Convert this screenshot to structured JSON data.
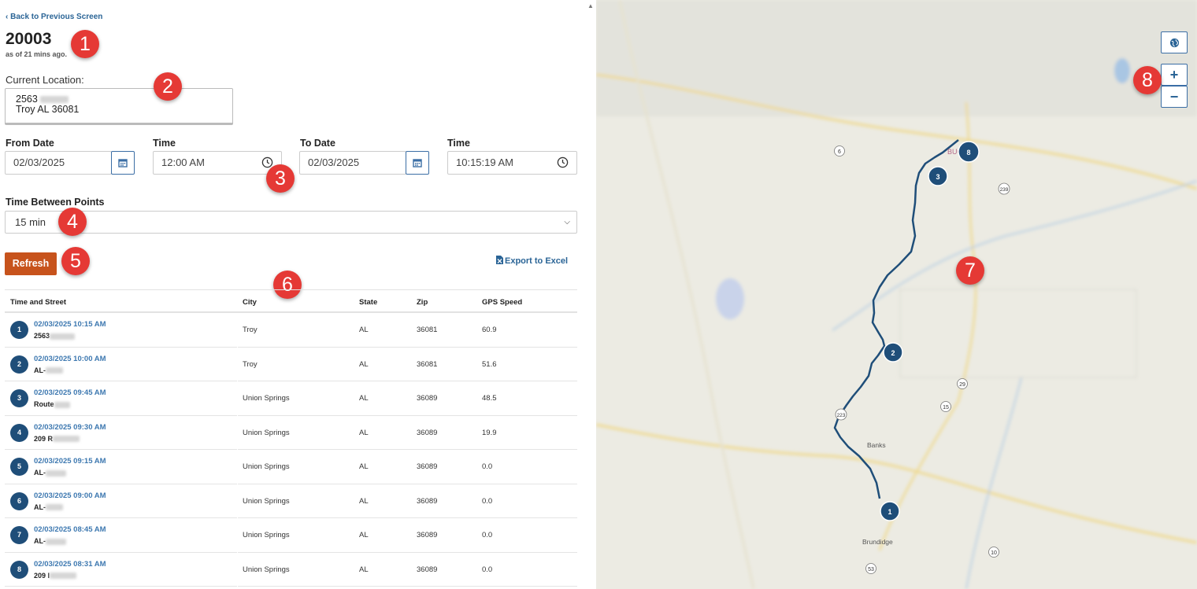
{
  "nav": {
    "back_label": "Back to Previous Screen"
  },
  "vehicle": {
    "id": "20003",
    "as_of": "as of 21 mins ago."
  },
  "callouts": [
    "1",
    "2",
    "3",
    "4",
    "5",
    "6",
    "7",
    "8"
  ],
  "location": {
    "label": "Current Location:",
    "line1": "2563",
    "line2": "Troy AL 36081"
  },
  "filters": {
    "from_date_label": "From Date",
    "from_date": "02/03/2025",
    "from_time_label": "Time",
    "from_time": "12:00 AM",
    "to_date_label": "To Date",
    "to_date": "02/03/2025",
    "to_time_label": "Time",
    "to_time": "10:15:19 AM",
    "interval_label": "Time Between Points",
    "interval": "15 min"
  },
  "actions": {
    "refresh": "Refresh",
    "export": "Export to Excel"
  },
  "table": {
    "columns": [
      "Time and Street",
      "City",
      "State",
      "Zip",
      "GPS Speed"
    ],
    "rows": [
      {
        "n": "1",
        "time": "02/03/2025 10:15 AM",
        "street": "2563",
        "city": "Troy",
        "state": "AL",
        "zip": "36081",
        "speed": "60.9"
      },
      {
        "n": "2",
        "time": "02/03/2025 10:00 AM",
        "street": "AL-",
        "city": "Troy",
        "state": "AL",
        "zip": "36081",
        "speed": "51.6"
      },
      {
        "n": "3",
        "time": "02/03/2025 09:45 AM",
        "street": "Route",
        "city": "Union Springs",
        "state": "AL",
        "zip": "36089",
        "speed": "48.5"
      },
      {
        "n": "4",
        "time": "02/03/2025 09:30 AM",
        "street": "209 R",
        "city": "Union Springs",
        "state": "AL",
        "zip": "36089",
        "speed": "19.9"
      },
      {
        "n": "5",
        "time": "02/03/2025 09:15 AM",
        "street": "AL-",
        "city": "Union Springs",
        "state": "AL",
        "zip": "36089",
        "speed": "0.0"
      },
      {
        "n": "6",
        "time": "02/03/2025 09:00 AM",
        "street": "AL-",
        "city": "Union Springs",
        "state": "AL",
        "zip": "36089",
        "speed": "0.0"
      },
      {
        "n": "7",
        "time": "02/03/2025 08:45 AM",
        "street": "AL-",
        "city": "Union Springs",
        "state": "AL",
        "zip": "36089",
        "speed": "0.0"
      },
      {
        "n": "8",
        "time": "02/03/2025 08:31 AM",
        "street": "209 I",
        "city": "Union Springs",
        "state": "AL",
        "zip": "36089",
        "speed": "0.0"
      }
    ]
  },
  "map": {
    "towns": [
      "BUCK",
      "Banks",
      "Brundidge"
    ],
    "road_shields": [
      "6",
      "239",
      "29",
      "15",
      "223",
      "10",
      "53"
    ],
    "markers": [
      "1",
      "2",
      "3",
      "8"
    ],
    "zoom_in": "+",
    "zoom_out": "−",
    "colors": {
      "route": "#1f4e79",
      "marker": "#1f4e79",
      "highway": "#f1d27a",
      "water": "#a9c6e3"
    }
  }
}
